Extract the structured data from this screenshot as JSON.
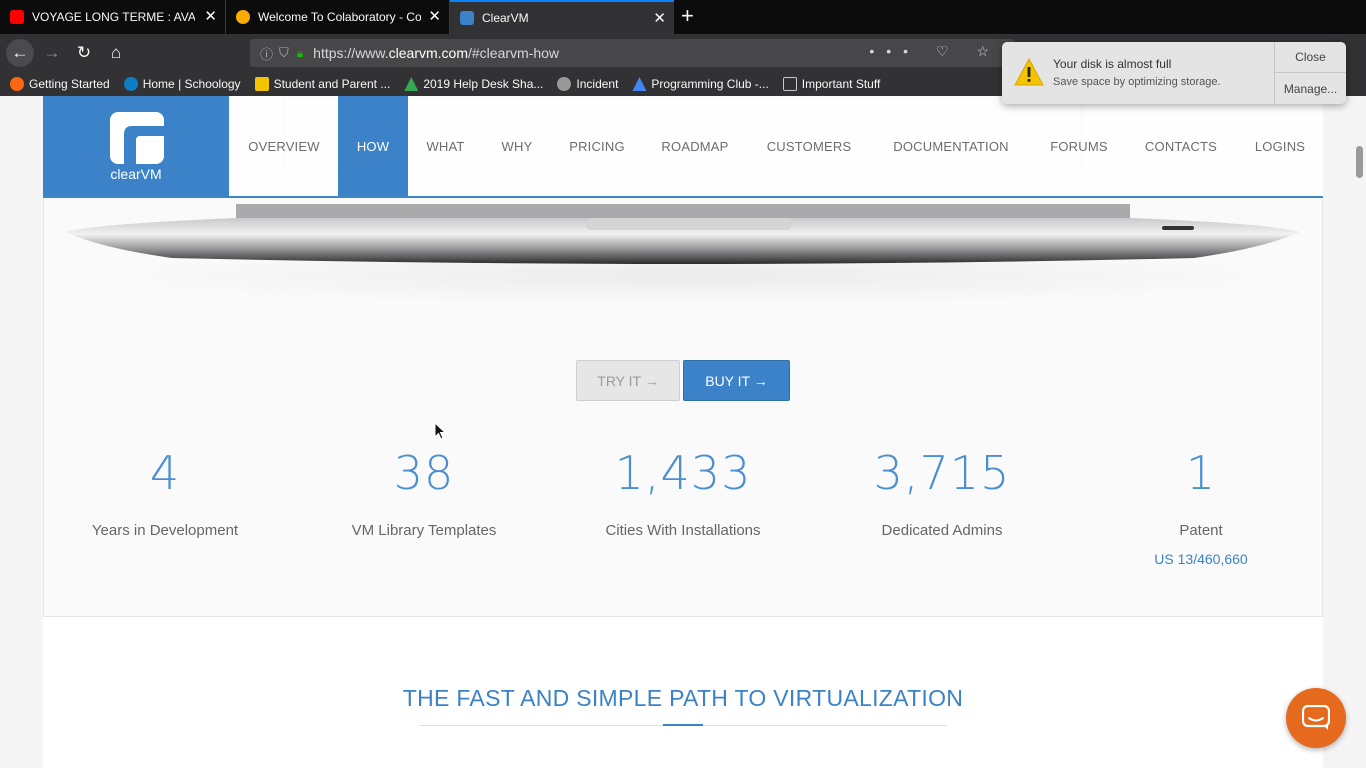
{
  "tabs": [
    {
      "title": "VOYAGE LONG TERME : AVANT",
      "favicon_color": "#ff0000"
    },
    {
      "title": "Welcome To Colaboratory - Col",
      "favicon_color": "#f9ab00"
    },
    {
      "title": "ClearVM",
      "favicon_color": "#3c82c8"
    }
  ],
  "url": {
    "prefix": "https://www.",
    "domain": "clearvm.com",
    "path": "/#clearvm-how"
  },
  "bookmarks": [
    {
      "label": "Getting Started",
      "color": "#ff6611"
    },
    {
      "label": "Home | Schoology",
      "color": "#0e7dc2"
    },
    {
      "label": "Student and Parent ...",
      "color": "#f2c500"
    },
    {
      "label": "2019 Help Desk Sha...",
      "color": "#34a853"
    },
    {
      "label": "Incident",
      "color": "#999999"
    },
    {
      "label": "Programming Club -...",
      "color": "#4285f4"
    },
    {
      "label": "Important Stuff",
      "color": "#c8c8c8"
    }
  ],
  "notification": {
    "title": "Your disk is almost full",
    "subtitle": "Save space by optimizing storage.",
    "close": "Close",
    "manage": "Manage..."
  },
  "logo": {
    "wordmark": "clearVM"
  },
  "nav": [
    "OVERVIEW",
    "HOW",
    "WHAT",
    "WHY",
    "PRICING",
    "ROADMAP",
    "CUSTOMERS",
    "DOCUMENTATION",
    "FORUMS",
    "CONTACTS",
    "LOGINS"
  ],
  "nav_active": "HOW",
  "buttons": {
    "try": "TRY IT →",
    "buy": "BUY IT →"
  },
  "stats": [
    {
      "value": "4",
      "label": "Years in Development"
    },
    {
      "value": "38",
      "label": "VM Library Templates"
    },
    {
      "value": "1,433",
      "label": "Cities With Installations"
    },
    {
      "value": "3,715",
      "label": "Dedicated Admins"
    },
    {
      "value": "1",
      "label": "Patent",
      "link": "US 13/460,660"
    }
  ],
  "section_title": "THE FAST AND SIMPLE PATH TO VIRTUALIZATION",
  "colors": {
    "brand": "#3c82c8",
    "chat": "#e66a1e"
  }
}
